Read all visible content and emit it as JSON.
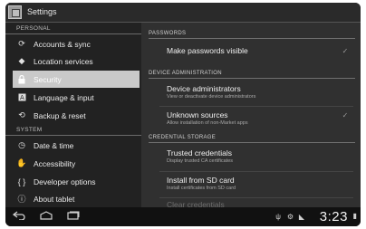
{
  "actionbar": {
    "title": "Settings",
    "icon": "settings-icon"
  },
  "sidebar": {
    "sections": [
      {
        "label": "PERSONAL"
      },
      {
        "label": "SYSTEM"
      }
    ],
    "items": [
      {
        "label": "Accounts & sync",
        "icon": "sync-icon"
      },
      {
        "label": "Location services",
        "icon": "location-icon"
      },
      {
        "label": "Security",
        "icon": "lock-icon",
        "selected": true
      },
      {
        "label": "Language & input",
        "icon": "keyboard-icon"
      },
      {
        "label": "Backup & reset",
        "icon": "backup-icon"
      },
      {
        "label": "Date & time",
        "icon": "clock-icon"
      },
      {
        "label": "Accessibility",
        "icon": "hand-icon"
      },
      {
        "label": "Developer options",
        "icon": "braces-icon"
      },
      {
        "label": "About tablet",
        "icon": "info-icon"
      }
    ]
  },
  "detail": {
    "sections": [
      {
        "label": "PASSWORDS"
      },
      {
        "label": "DEVICE ADMINISTRATION"
      },
      {
        "label": "CREDENTIAL STORAGE"
      }
    ],
    "items": [
      {
        "title": "Make passwords visible",
        "checkbox": true
      },
      {
        "title": "Device administrators",
        "subtitle": "View or deactivate device administrators"
      },
      {
        "title": "Unknown sources",
        "subtitle": "Allow installation of non-Market apps",
        "checkbox": true
      },
      {
        "title": "Trusted credentials",
        "subtitle": "Display trusted CA certificates"
      },
      {
        "title": "Install from SD card",
        "subtitle": "Install certificates from SD card"
      },
      {
        "title": "Clear credentials"
      }
    ]
  },
  "systembar": {
    "time": "3:23",
    "buttons": [
      "back-icon",
      "home-icon",
      "recent-apps-icon"
    ]
  }
}
